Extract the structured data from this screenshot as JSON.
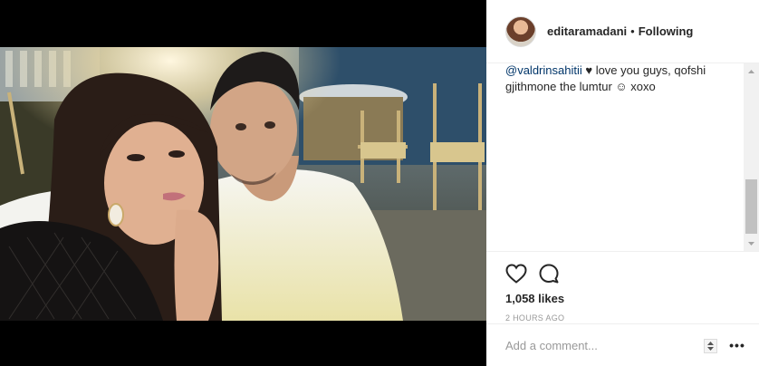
{
  "post": {
    "username": "editaramadani",
    "separator": "•",
    "follow_status": "Following",
    "caption": {
      "mention": "@valdrinsahitii",
      "heart": "♥",
      "text": " love you guys, qofshi gjithmone the lumtur ☺ xoxo"
    },
    "likes": "1,058 likes",
    "time_ago": "2 HOURS AGO",
    "comment_placeholder": "Add a comment...",
    "more_label": "•••"
  },
  "icons": {
    "like": "heart-outline-icon",
    "comment": "speech-bubble-icon",
    "more": "ellipsis-icon"
  },
  "colors": {
    "mention": "#003569",
    "text": "#262626",
    "muted": "#999999",
    "divider": "#efefef"
  }
}
